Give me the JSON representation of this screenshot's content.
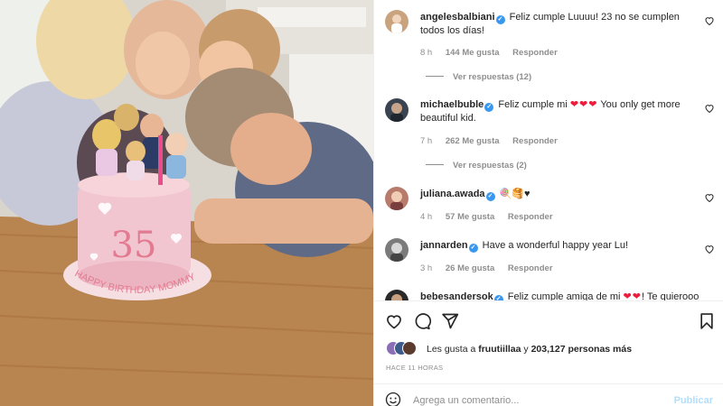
{
  "comments": [
    {
      "username": "angelesbalbiani",
      "verified": true,
      "text": "Feliz cumple Luuuu! 23 no se cumplen todos los días!",
      "time": "8 h",
      "likes": "144 Me gusta",
      "reply_label": "Responder",
      "view_replies": "Ver respuestas (12)",
      "avatar_color": "#c9a27e"
    },
    {
      "username": "michaelbuble",
      "verified": true,
      "text_before": "Feliz cumple mi",
      "hearts": "❤❤❤",
      "text_after": "You only get more beautiful kid.",
      "time": "7 h",
      "likes": "262 Me gusta",
      "reply_label": "Responder",
      "view_replies": "Ver respuestas (2)",
      "avatar_color": "#3a4450"
    },
    {
      "username": "juliana.awada",
      "verified": true,
      "text": "🍭🥞♥",
      "time": "4 h",
      "likes": "57 Me gusta",
      "reply_label": "Responder",
      "avatar_color": "#b87a6a"
    },
    {
      "username": "jannarden",
      "verified": true,
      "text": "Have a wonderful happy year Lu!",
      "time": "3 h",
      "likes": "26 Me gusta",
      "reply_label": "Responder",
      "avatar_color": "#7b7b7b"
    },
    {
      "username": "bebesandersok",
      "verified": true,
      "text_before": "Feliz cumple amiga de mi",
      "hearts": "❤❤",
      "text_after": "! Te quierooo",
      "avatar_color": "#2a2a2a"
    }
  ],
  "actions": {
    "like_icon": "heart-icon",
    "comment_icon": "comment-icon",
    "share_icon": "share-icon",
    "save_icon": "bookmark-icon"
  },
  "likes_summary": {
    "prefix": "Les gusta a",
    "first_user": "fruutiillaa",
    "middle": "y",
    "count": "203,127 personas más"
  },
  "timestamp": "HACE 11 HORAS",
  "add_comment": {
    "placeholder": "Agrega un comentario...",
    "post_label": "Publicar",
    "emoji_icon": "smiley-icon"
  },
  "photo": {
    "cake_text": "35",
    "cake_message": "HAPPY BIRTHDAY MOMMY"
  },
  "colors": {
    "verified": "#3897f0",
    "heart": "#ed1c3a",
    "muted": "#8e8e8e",
    "post_disabled": "#b2dffc"
  }
}
